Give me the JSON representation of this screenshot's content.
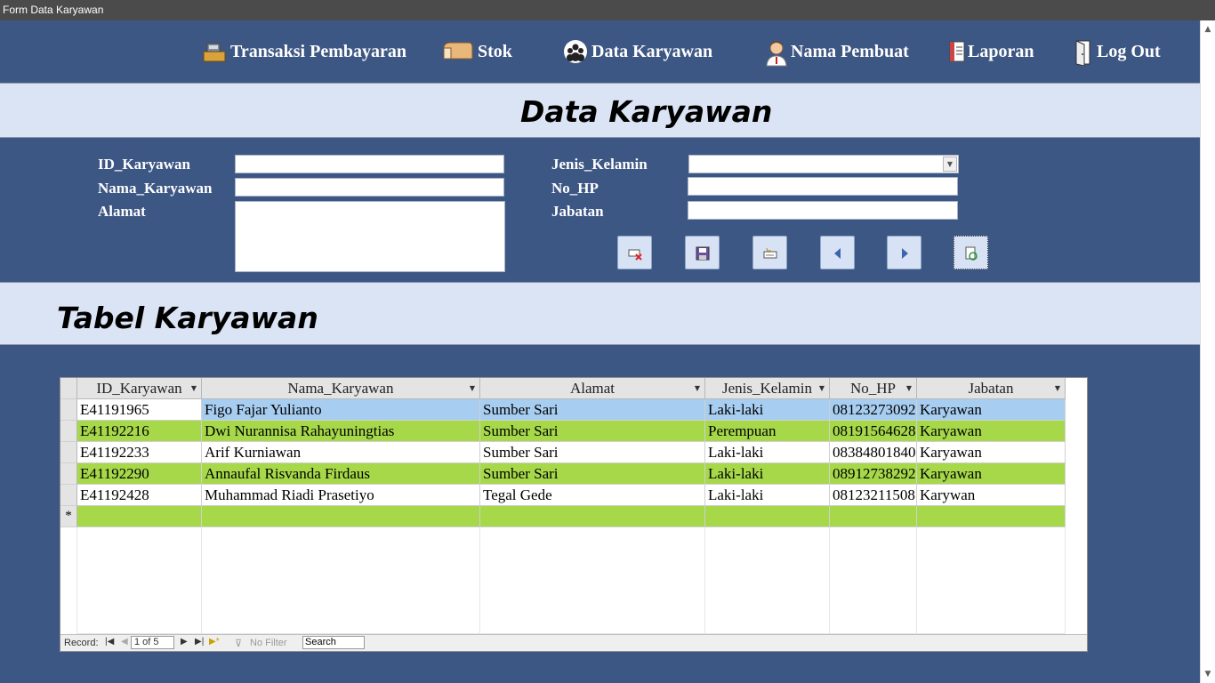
{
  "window": {
    "title": "Form Data Karyawan"
  },
  "nav": [
    {
      "label": "Transaksi Pembayaran",
      "icon": "cash-register-icon"
    },
    {
      "label": "Stok",
      "icon": "bread-icon"
    },
    {
      "label": "Data Karyawan",
      "icon": "people-icon"
    },
    {
      "label": "Nama Pembuat",
      "icon": "person-icon"
    },
    {
      "label": "Laporan",
      "icon": "report-icon"
    },
    {
      "label": "Log Out",
      "icon": "exit-door-icon"
    }
  ],
  "page_title": "Data Karyawan",
  "form": {
    "labels": {
      "id": "ID_Karyawan",
      "nama": "Nama_Karyawan",
      "alamat": "Alamat",
      "jk": "Jenis_Kelamin",
      "hp": "No_HP",
      "jabatan": "Jabatan"
    },
    "values": {
      "id": "",
      "nama": "",
      "alamat": "",
      "jk": "",
      "hp": "",
      "jabatan": ""
    }
  },
  "buttons": [
    "delete-record-icon",
    "save-icon",
    "new-record-icon",
    "previous-icon",
    "next-icon",
    "refresh-icon"
  ],
  "table_title": "Tabel Karyawan",
  "grid": {
    "columns": [
      "ID_Karyawan",
      "Nama_Karyawan",
      "Alamat",
      "Jenis_Kelamin",
      "No_HP",
      "Jabatan"
    ],
    "rows": [
      [
        "E41191965",
        "Figo Fajar Yulianto",
        "Sumber Sari",
        "Laki-laki",
        "08123273092",
        "Karyawan"
      ],
      [
        "E41192216",
        "Dwi Nurannisa Rahayuningtias",
        "Sumber Sari",
        "Perempuan",
        "08191564628",
        "Karyawan"
      ],
      [
        "E41192233",
        "Arif Kurniawan",
        "Sumber Sari",
        "Laki-laki",
        "08384801840",
        "Karyawan"
      ],
      [
        "E41192290",
        "Annaufal Risvanda Firdaus",
        "Sumber Sari",
        "Laki-laki",
        "08912738292",
        "Karyawan"
      ],
      [
        "E41192428",
        "Muhammad Riadi Prasetiyo",
        "Tegal Gede",
        "Laki-laki",
        "08123211508",
        "Karywan"
      ]
    ],
    "new_row_marker": "*"
  },
  "record_nav": {
    "label": "Record:",
    "position": "1 of 5",
    "filter": "No Filter",
    "search": "Search"
  },
  "colors": {
    "background": "#3d5784",
    "band": "#dbe4f4",
    "row_selected": "#a7cdf0",
    "row_alt": "#a6d84a"
  }
}
